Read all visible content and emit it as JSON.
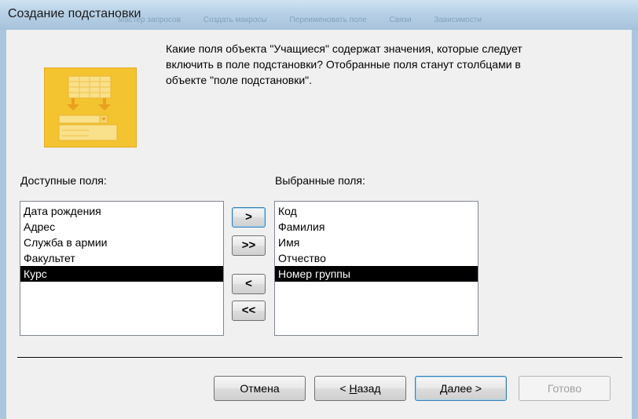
{
  "window": {
    "title": "Создание подстановки",
    "background_text": [
      "Мастер запросов",
      "Создать макросы",
      "Переименовать поле",
      "Связи",
      "Зависимости"
    ]
  },
  "question": {
    "lines": [
      "Какие поля объекта \"Учащиеся\" содержат значения, которые следует",
      "включить в поле подстановки? Отобранные поля станут столбцами в",
      "объекте \"поле подстановки\"."
    ]
  },
  "available": {
    "label": "Доступные поля:",
    "items": [
      "Дата рождения",
      "Адрес",
      "Служба в армии",
      "Факультет",
      "Курс"
    ],
    "selected_index": 4
  },
  "selected": {
    "label": "Выбранные поля:",
    "items": [
      "Код",
      "Фамилия",
      "Имя",
      "Отчество",
      "Номер группы"
    ],
    "selected_index": 4
  },
  "move_buttons": {
    "add_one": ">",
    "add_all": ">>",
    "remove_one": "<",
    "remove_all": "<<"
  },
  "footer": {
    "cancel": "Отмена",
    "back_mnemonic": "Н",
    "back_rest": "азад",
    "back_prefix": "< ",
    "next_mnemonic": "Д",
    "next_rest": "алее >",
    "finish": "Готово"
  },
  "colors": {
    "selection": "#000000",
    "wizard_icon": "#f4c430",
    "focus_border": "#3c7fb1"
  }
}
